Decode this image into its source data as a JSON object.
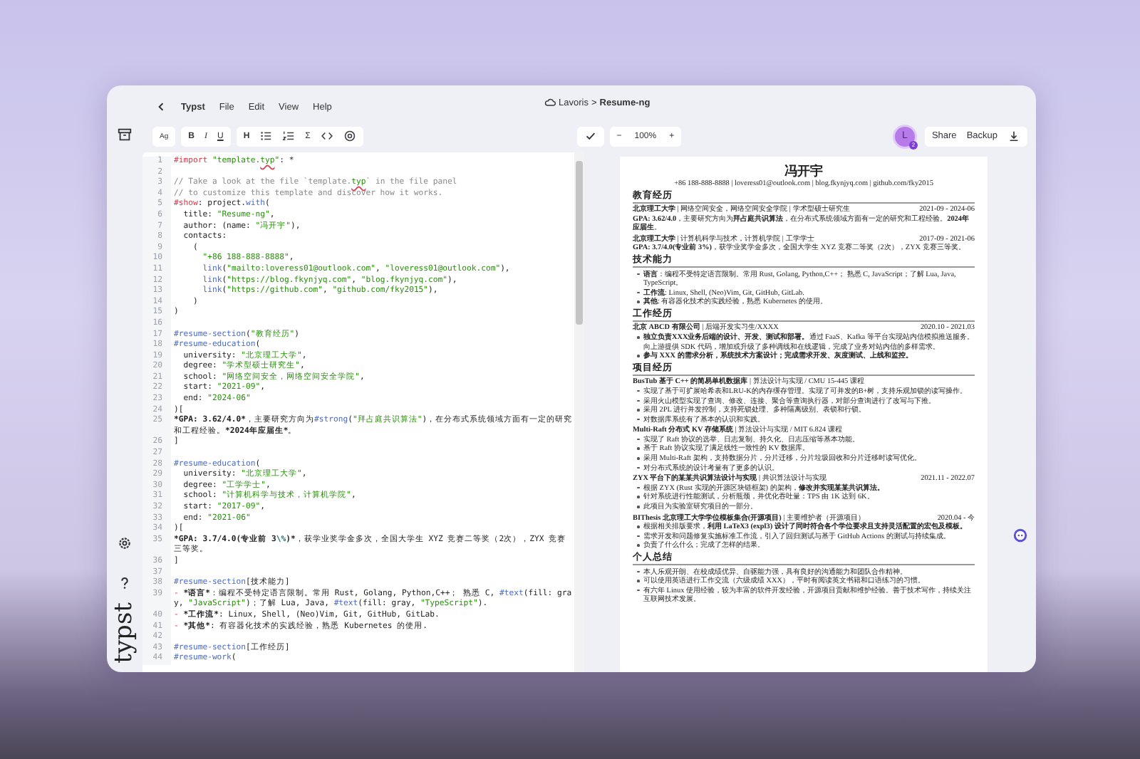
{
  "menu": {
    "app": "Typst",
    "items": [
      "File",
      "Edit",
      "View",
      "Help"
    ]
  },
  "breadcrumb": {
    "project": "Lavoris",
    "separator": ">",
    "file": "Resume-ng"
  },
  "toolbar": {
    "groups": [
      [
        {
          "kind": "font",
          "text": "Ag"
        }
      ],
      [
        {
          "kind": "bold",
          "text": "B"
        },
        {
          "kind": "italic",
          "text": "I"
        },
        {
          "kind": "underline",
          "text": "U"
        }
      ],
      [
        {
          "kind": "heading",
          "text": "H"
        },
        {
          "kind": "bullet-list"
        },
        {
          "kind": "numbered-list"
        },
        {
          "kind": "math",
          "text": "Σ"
        },
        {
          "kind": "code"
        },
        {
          "kind": "reference"
        }
      ]
    ],
    "zoom": {
      "minus": "−",
      "value": "100%",
      "plus": "+"
    },
    "user": {
      "initial": "L",
      "badge": "2"
    },
    "actions": [
      "Share",
      "Backup"
    ]
  },
  "sidebar": {
    "logo": "typst"
  },
  "editor": {
    "lines": [
      {
        "no": "1",
        "parts": [
          {
            "kind": "kw",
            "text": "#import "
          },
          {
            "kind": "str",
            "text": "\"template."
          },
          {
            "kind": "err",
            "text": "typ"
          },
          {
            "kind": "str",
            "text": "\""
          },
          {
            "kind": "tx",
            "text": ": *"
          }
        ]
      },
      {
        "no": "2"
      },
      {
        "no": "3",
        "parts": [
          {
            "kind": "cm",
            "text": "// Take a look at the file `template."
          },
          {
            "kind": "err",
            "text": "typ"
          },
          {
            "kind": "cm",
            "text": "` in the file panel"
          }
        ]
      },
      {
        "no": "4",
        "parts": [
          {
            "kind": "cm",
            "text": "// to customize this template and discover how it works."
          }
        ]
      },
      {
        "no": "5",
        "parts": [
          {
            "kind": "kw",
            "text": "#show"
          },
          {
            "kind": "tx",
            "text": ": project."
          },
          {
            "kind": "fn",
            "text": "with"
          },
          {
            "kind": "tx",
            "text": "("
          }
        ]
      },
      {
        "no": "6",
        "parts": [
          {
            "kind": "tx",
            "text": "  title: "
          },
          {
            "kind": "str",
            "text": "\"Resume-ng\""
          },
          {
            "kind": "tx",
            "text": ","
          }
        ]
      },
      {
        "no": "7",
        "parts": [
          {
            "kind": "tx",
            "text": "  author: (name: "
          },
          {
            "kind": "str",
            "text": "\"冯开宇\""
          },
          {
            "kind": "tx",
            "text": "),"
          }
        ]
      },
      {
        "no": "8",
        "parts": [
          {
            "kind": "tx",
            "text": "  contacts:"
          }
        ]
      },
      {
        "no": "9",
        "parts": [
          {
            "kind": "tx",
            "text": "    ("
          }
        ]
      },
      {
        "no": "10",
        "parts": [
          {
            "kind": "str",
            "text": "      \"+86 188-888-8888\""
          },
          {
            "kind": "tx",
            "text": ","
          }
        ]
      },
      {
        "no": "11",
        "parts": [
          {
            "kind": "fn",
            "text": "      link"
          },
          {
            "kind": "tx",
            "text": "("
          },
          {
            "kind": "str",
            "text": "\"mailto:loveress01@outlook.com\""
          },
          {
            "kind": "tx",
            "text": ", "
          },
          {
            "kind": "str",
            "text": "\"loveress01@outlook.com\""
          },
          {
            "kind": "tx",
            "text": "),"
          }
        ]
      },
      {
        "no": "12",
        "parts": [
          {
            "kind": "fn",
            "text": "      link"
          },
          {
            "kind": "tx",
            "text": "("
          },
          {
            "kind": "str",
            "text": "\"https://blog.fkynjyq.com\""
          },
          {
            "kind": "tx",
            "text": ", "
          },
          {
            "kind": "str",
            "text": "\"blog.fkynjyq.com\""
          },
          {
            "kind": "tx",
            "text": "),"
          }
        ]
      },
      {
        "no": "13",
        "parts": [
          {
            "kind": "fn",
            "text": "      link"
          },
          {
            "kind": "tx",
            "text": "("
          },
          {
            "kind": "str",
            "text": "\"https://github.com\""
          },
          {
            "kind": "tx",
            "text": ", "
          },
          {
            "kind": "str",
            "text": "\"github.com/fky2015\""
          },
          {
            "kind": "tx",
            "text": "),"
          }
        ]
      },
      {
        "no": "14",
        "parts": [
          {
            "kind": "tx",
            "text": "    )"
          }
        ]
      },
      {
        "no": "15",
        "parts": [
          {
            "kind": "tx",
            "text": ")"
          }
        ]
      },
      {
        "no": "16"
      },
      {
        "no": "17",
        "parts": [
          {
            "kind": "fn",
            "text": "#resume-section"
          },
          {
            "kind": "tx",
            "text": "("
          },
          {
            "kind": "str",
            "text": "\"教育经历\""
          },
          {
            "kind": "tx",
            "text": ")"
          }
        ]
      },
      {
        "no": "18",
        "parts": [
          {
            "kind": "fn",
            "text": "#resume-education"
          },
          {
            "kind": "tx",
            "text": "("
          }
        ]
      },
      {
        "no": "19",
        "parts": [
          {
            "kind": "tx",
            "text": "  university: "
          },
          {
            "kind": "str",
            "text": "\"北京理工大学\""
          },
          {
            "kind": "tx",
            "text": ","
          }
        ]
      },
      {
        "no": "20",
        "parts": [
          {
            "kind": "tx",
            "text": "  degree: "
          },
          {
            "kind": "str",
            "text": "\"学术型硕士研究生\""
          },
          {
            "kind": "tx",
            "text": ","
          }
        ]
      },
      {
        "no": "21",
        "parts": [
          {
            "kind": "tx",
            "text": "  school: "
          },
          {
            "kind": "str",
            "text": "\"网络空间安全，网络空间安全学院\""
          },
          {
            "kind": "tx",
            "text": ","
          }
        ]
      },
      {
        "no": "22",
        "parts": [
          {
            "kind": "tx",
            "text": "  start: "
          },
          {
            "kind": "str",
            "text": "\"2021-09\""
          },
          {
            "kind": "tx",
            "text": ","
          }
        ]
      },
      {
        "no": "23",
        "parts": [
          {
            "kind": "tx",
            "text": "  end: "
          },
          {
            "kind": "str",
            "text": "\"2024-06\""
          }
        ]
      },
      {
        "no": "24",
        "parts": [
          {
            "kind": "tx",
            "text": ")["
          }
        ]
      },
      {
        "no": "25",
        "parts": [
          {
            "kind": "bold",
            "text": "*GPA: 3.62/4.0*"
          },
          {
            "kind": "tx",
            "text": "，主要研究方向为"
          },
          {
            "kind": "fn",
            "text": "#strong"
          },
          {
            "kind": "tx",
            "text": "("
          },
          {
            "kind": "str",
            "text": "\"拜占庭共识算法\""
          },
          {
            "kind": "tx",
            "text": ")，在分布式系统领域方面有一定的研究和工程经验。"
          },
          {
            "kind": "bold",
            "text": "*2024年应届生*"
          },
          {
            "kind": "tx",
            "text": "。"
          }
        ]
      },
      {
        "no": "26",
        "parts": [
          {
            "kind": "tx",
            "text": "]"
          }
        ]
      },
      {
        "no": "27"
      },
      {
        "no": "28",
        "parts": [
          {
            "kind": "fn",
            "text": "#resume-education"
          },
          {
            "kind": "tx",
            "text": "("
          }
        ]
      },
      {
        "no": "29",
        "parts": [
          {
            "kind": "tx",
            "text": "  university: "
          },
          {
            "kind": "str",
            "text": "\"北京理工大学\""
          },
          {
            "kind": "tx",
            "text": ","
          }
        ]
      },
      {
        "no": "30",
        "parts": [
          {
            "kind": "tx",
            "text": "  degree: "
          },
          {
            "kind": "str",
            "text": "\"工学学士\""
          },
          {
            "kind": "tx",
            "text": ","
          }
        ]
      },
      {
        "no": "31",
        "parts": [
          {
            "kind": "tx",
            "text": "  school: "
          },
          {
            "kind": "str",
            "text": "\"计算机科学与技术，计算机学院\""
          },
          {
            "kind": "tx",
            "text": ","
          }
        ]
      },
      {
        "no": "32",
        "parts": [
          {
            "kind": "tx",
            "text": "  start: "
          },
          {
            "kind": "str",
            "text": "\"2017-09\""
          },
          {
            "kind": "tx",
            "text": ","
          }
        ]
      },
      {
        "no": "33",
        "parts": [
          {
            "kind": "tx",
            "text": "  end: "
          },
          {
            "kind": "str",
            "text": "\"2021-06\""
          }
        ]
      },
      {
        "no": "34",
        "parts": [
          {
            "kind": "tx",
            "text": ")["
          }
        ]
      },
      {
        "no": "35",
        "parts": [
          {
            "kind": "bold",
            "text": "*GPA: 3.7/4.0(专业前 3"
          },
          {
            "kind": "esc",
            "text": "\\%"
          },
          {
            "kind": "bold",
            "text": ")*"
          },
          {
            "kind": "tx",
            "text": "，获学业奖学金多次，全国大学生 XYZ 竞赛二等奖（2次），ZYX 竞赛三等奖。"
          }
        ]
      },
      {
        "no": "36",
        "parts": [
          {
            "kind": "tx",
            "text": "]"
          }
        ]
      },
      {
        "no": "37"
      },
      {
        "no": "38",
        "parts": [
          {
            "kind": "fn",
            "text": "#resume-section"
          },
          {
            "kind": "tx",
            "text": "[技术能力]"
          }
        ]
      },
      {
        "no": "39",
        "parts": [
          {
            "kind": "kw",
            "text": "- "
          },
          {
            "kind": "bold",
            "text": "*语言*"
          },
          {
            "kind": "tx",
            "text": "：编程不受特定语言限制。常用 Rust, Golang, Python,C++； 熟悉 C, "
          },
          {
            "kind": "fn",
            "text": "#text"
          },
          {
            "kind": "tx",
            "text": "(fill: gray, "
          },
          {
            "kind": "str",
            "text": "\"JavaScript\""
          },
          {
            "kind": "tx",
            "text": ")；了解 Lua, Java, "
          },
          {
            "kind": "fn",
            "text": "#text"
          },
          {
            "kind": "tx",
            "text": "(fill: gray, "
          },
          {
            "kind": "str",
            "text": "\"TypeScript\""
          },
          {
            "kind": "tx",
            "text": ")."
          }
        ]
      },
      {
        "no": "40",
        "parts": [
          {
            "kind": "kw",
            "text": "- "
          },
          {
            "kind": "bold",
            "text": "*工作流*"
          },
          {
            "kind": "tx",
            "text": ": Linux, Shell, (Neo)Vim, Git, GitHub, GitLab."
          }
        ]
      },
      {
        "no": "41",
        "parts": [
          {
            "kind": "kw",
            "text": "- "
          },
          {
            "kind": "bold",
            "text": "*其他*"
          },
          {
            "kind": "tx",
            "text": ": 有容器化技术的实践经验，熟悉 Kubernetes 的使用."
          }
        ]
      },
      {
        "no": "42"
      },
      {
        "no": "43",
        "parts": [
          {
            "kind": "fn",
            "text": "#resume-section"
          },
          {
            "kind": "tx",
            "text": "[工作经历]"
          }
        ]
      },
      {
        "no": "44",
        "parts": [
          {
            "kind": "fn",
            "text": "#resume-work"
          },
          {
            "kind": "tx",
            "text": "("
          }
        ]
      }
    ]
  },
  "preview": {
    "name": "冯开宇",
    "contacts": "+86 188-888-8888 | loveress01@outlook.com | blog.fkynjyq.com | github.com/fky2015",
    "sections": [
      {
        "title": "教育经历",
        "items": [
          {
            "kind": "entry",
            "heading": "**北京理工大学** | 网络空间安全，网络空间安全学院 | 学术型硕士研究生",
            "date": "2021-09 - 2024-06",
            "text": "**GPA: 3.62/4.0**，主要研究方向为**拜占庭共识算法**，在分布式系统领域方面有一定的研究和工程经验。**2024年应届生**。"
          },
          {
            "kind": "entry",
            "heading": "**北京理工大学** | 计算机科学与技术，计算机学院 | 工学学士",
            "date": "2017-09 - 2021-06",
            "text": "**GPA: 3.7/4.0(专业前 3%)**，获学业奖学金多次，全国大学生 XYZ 竞赛二等奖（2次），ZYX 竞赛三等奖。"
          }
        ]
      },
      {
        "title": "技术能力",
        "items": [
          {
            "kind": "bullet",
            "text": "**语言**：编程不受特定语言限制。常用 Rust, Golang, Python,C++； 熟悉 C, JavaScript；了解 Lua, Java, TypeScript。"
          },
          {
            "kind": "bullet",
            "text": "**工作流**: Linux, Shell, (Neo)Vim, Git, GitHub, GitLab."
          },
          {
            "kind": "bullet",
            "text": "**其他**: 有容器化技术的实践经验，熟悉 Kubernetes 的使用。"
          }
        ]
      },
      {
        "title": "工作经历",
        "items": [
          {
            "kind": "entry",
            "heading": "**北京 ABCD 有限公司** | 后端开发实习生/XXXX",
            "date": "2020.10 - 2021.03",
            "bullets": [
              "**独立负责XXX业务后端的设计、开发、测试和部署。**通过 FaaS、Kafka 等平台实现站内信模拟推送服务。向上游提供 SDK 代码，增加或升级了多种调线和在线逻辑，完成了业务对站内信的多样需求。",
              "**参与 XXX 的需求分析，系统技术方案设计；完成需求开发、灰度测试、上线和监控。**"
            ]
          }
        ]
      },
      {
        "title": "项目经历",
        "items": [
          {
            "kind": "entry",
            "heading": "**BusTub 基于 C++ 的简易单机数据库** | 算法设计与实现 / CMU 15-445 课程",
            "bullets": [
              "实现了基于可扩展哈希表和LRU-K的内存缓存管理。实现了可并发的B+树，支持乐观加锁的读写操作。",
              "采用火山模型实现了查询、修改、连接、聚合等查询执行器，对部分查询进行了改写与下推。",
              "采用 2PL 进行并发控制，支持死锁处理、多种隔离级别、表锁和行锁。",
              "对数据库系统有了基本的认识和实践。"
            ]
          },
          {
            "kind": "entry",
            "heading": "**Multi-Raft 分布式 KV 存储系统** | 算法设计与实现 / MIT 6.824 课程",
            "bullets": [
              "实现了 Raft 协议的选举、日志复制、持久化、日志压缩等基本功能。",
              "基于 Raft 协议实现了满足线性一致性的 KV 数据库。",
              "采用 Multi-Raft 架构，支持数据分片，分片迁移，分片垃圾回收和分片迁移时读写优化。",
              "对分布式系统的设计考量有了更多的认识。"
            ]
          },
          {
            "kind": "entry",
            "heading": "**ZYX 平台下的某某共识算法设计与实现** | 共识算法设计与实现",
            "date": "2021.11 - 2022.07",
            "bullets": [
              "根据 ZYX (Rust 实现的开源区块链框架) 的架构，**修改并实现某某共识算法。**",
              "针对系统进行性能测试，分析瓶颈，并优化吞吐量：TPS 由 1K 达到 6K。",
              "此项目为实验室研究项目的一部分。"
            ]
          },
          {
            "kind": "entry",
            "heading": "**BIThesis 北京理工大学学位模板集合(开源项目)** | 主要维护者（开源项目）",
            "date": "2020.04 - 今",
            "bullets": [
              "根据相关排版要求，**利用 LaTeX3 (expl3) 设计了同时符合各个学位要求且支持灵活配置的宏包及模板。**",
              "需求开发和问题修复实施标准工作流，引入了回归测试与基于 GitHub Actions 的测试与持续集成。",
              "负责了什么什么；完成了怎样的结果。"
            ]
          }
        ]
      },
      {
        "title": "个人总结",
        "items": [
          {
            "kind": "bullet",
            "text": "本人乐观开朗、在校成绩优异、自驱能力强，具有良好的沟通能力和团队合作精神。"
          },
          {
            "kind": "bullet",
            "text": "可以使用英语进行工作交流（六级成绩 XXX），平时有阅读英文书籍和口语练习的习惯。"
          },
          {
            "kind": "bullet",
            "text": "有六年 Linux 使用经验，较为丰富的软件开发经验，开源项目贡献和维护经验。善于技术写作，持续关注互联网技术发展。"
          }
        ]
      }
    ]
  }
}
